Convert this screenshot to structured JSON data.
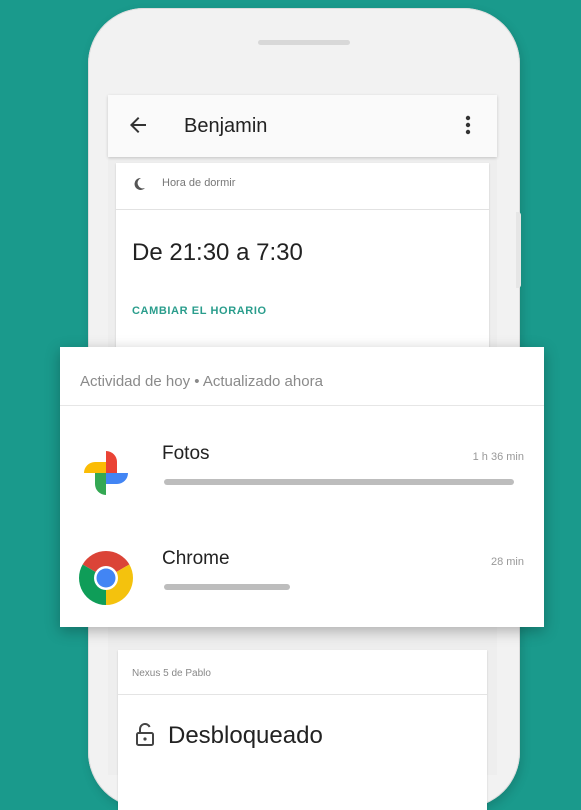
{
  "header": {
    "title": "Benjamin"
  },
  "bedtime": {
    "label": "Hora de dormir",
    "range": "De 21:30 a 7:30",
    "change_label": "CAMBIAR EL HORARIO"
  },
  "activity": {
    "title": "Actividad de hoy • Actualizado ahora",
    "apps": [
      {
        "name": "Fotos",
        "usage": "1 h 36 min",
        "usage_fraction": 1.0,
        "icon": "google-photos-icon"
      },
      {
        "name": "Chrome",
        "usage": "28 min",
        "usage_fraction": 0.36,
        "icon": "chrome-icon"
      }
    ]
  },
  "device": {
    "label": "Nexus 5 de Pablo",
    "status": "Desbloqueado"
  },
  "colors": {
    "background": "#1a9a8c",
    "accent": "#2a9d8c"
  }
}
